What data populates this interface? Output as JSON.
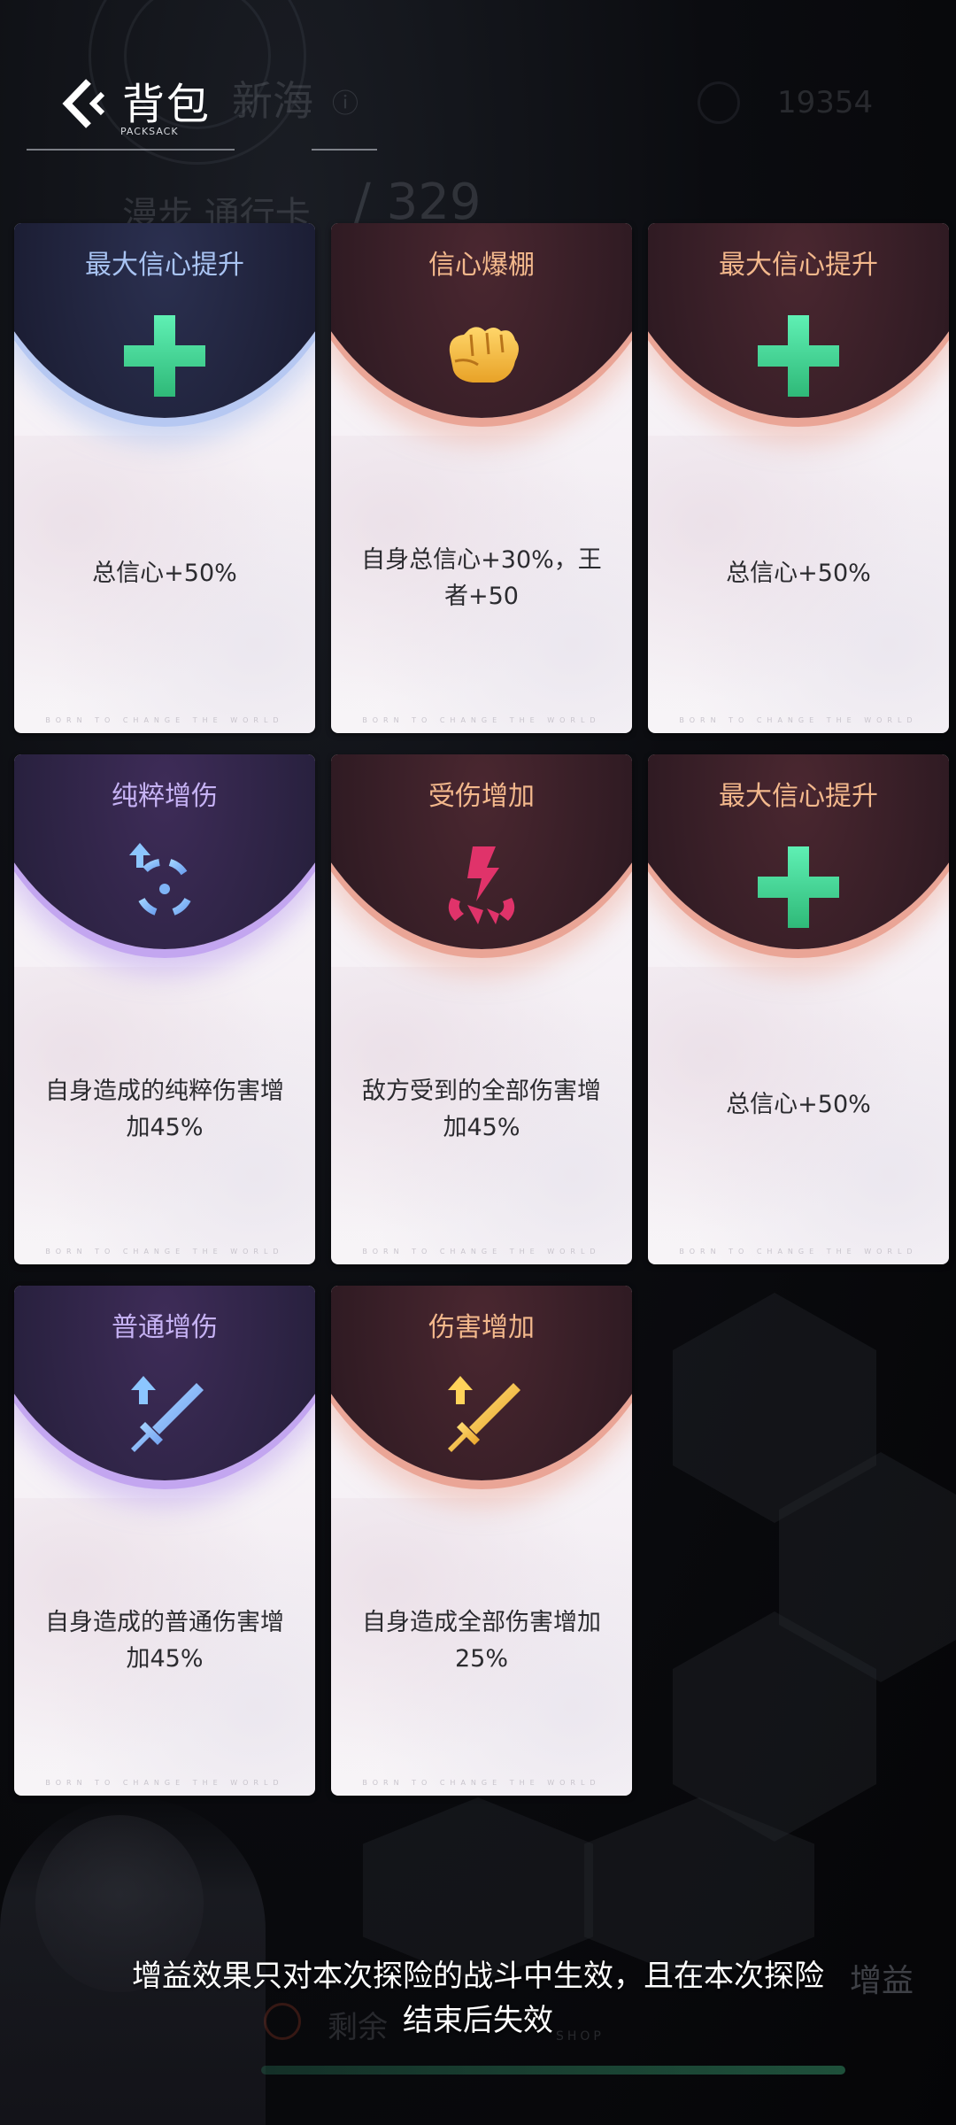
{
  "header": {
    "title": "背包",
    "subtitle": "PACKSACK"
  },
  "background": {
    "area_name": "新海",
    "currency_value": "19354",
    "pass_label": "漫步 通行卡",
    "pass_count": "/ 329",
    "buff_label": "增益",
    "remaining_label": "剩余",
    "shop_label": "SHOP"
  },
  "cards": [
    {
      "title": "最大信心提升",
      "icon": "green-plus-icon",
      "description": "总信心+50%",
      "footer": "BORN TO CHANGE THE WORLD",
      "theme": "blue"
    },
    {
      "title": "信心爆棚",
      "icon": "golden-fist-icon",
      "description": "自身总信心+30%，王者+50",
      "footer": "BORN TO CHANGE THE WORLD",
      "theme": "red"
    },
    {
      "title": "最大信心提升",
      "icon": "green-plus-icon",
      "description": "总信心+50%",
      "footer": "BORN TO CHANGE THE WORLD",
      "theme": "red"
    },
    {
      "title": "纯粹增伤",
      "icon": "crosshair-up-arrow-icon",
      "description": "自身造成的纯粹伤害增加45%",
      "footer": "BORN TO CHANGE THE WORLD",
      "theme": "purple"
    },
    {
      "title": "受伤增加",
      "icon": "broken-lightning-icon",
      "description": "敌方受到的全部伤害增加45%",
      "footer": "BORN TO CHANGE THE WORLD",
      "theme": "red"
    },
    {
      "title": "最大信心提升",
      "icon": "green-plus-icon",
      "description": "总信心+50%",
      "footer": "BORN TO CHANGE THE WORLD",
      "theme": "red"
    },
    {
      "title": "普通增伤",
      "icon": "blue-sword-up-arrow-icon",
      "description": "自身造成的普通伤害增加45%",
      "footer": "BORN TO CHANGE THE WORLD",
      "theme": "purple"
    },
    {
      "title": "伤害增加",
      "icon": "gold-sword-up-arrow-icon",
      "description": "自身造成全部伤害增加25%",
      "footer": "BORN TO CHANGE THE WORLD",
      "theme": "red"
    }
  ],
  "notice": {
    "line1": "增益效果只对本次探险的战斗中生效，且在本次探险",
    "line2": "结束后失效"
  },
  "colors": {
    "accent_green": "#4fe0a0",
    "title_blue": "#a9c4f3",
    "title_orange": "#f3b88c",
    "title_purple": "#c6b2f4"
  }
}
